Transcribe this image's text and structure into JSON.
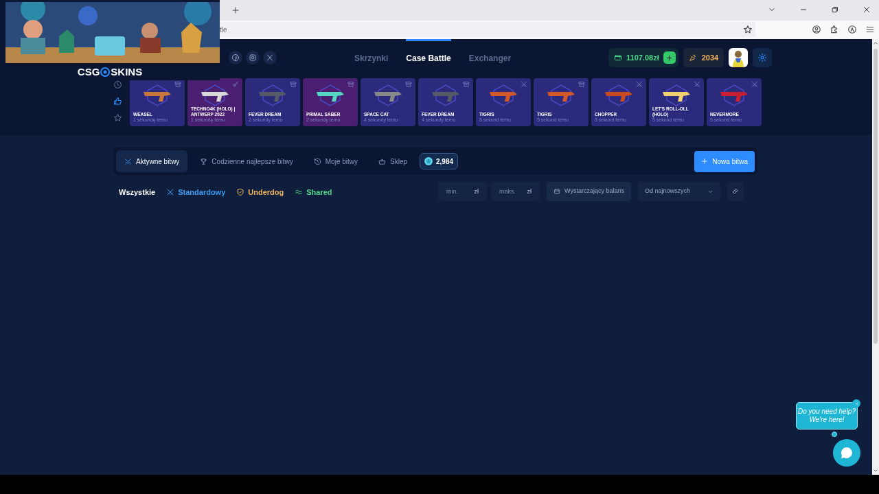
{
  "browser": {
    "address_fragment": "tle"
  },
  "overlay": {
    "logo_left": "CSG",
    "logo_right": "SKINS"
  },
  "nav": [
    {
      "label": "Skrzynki",
      "selected": false
    },
    {
      "label": "Case Battle",
      "selected": true
    },
    {
      "label": "Exchanger",
      "selected": false
    }
  ],
  "wallet": {
    "balance": "1107.08zł"
  },
  "points": "2034",
  "feed_filters": [
    {
      "kind": "recent",
      "selected": false
    },
    {
      "kind": "top",
      "selected": true
    },
    {
      "kind": "favorite",
      "selected": false
    }
  ],
  "drops": [
    {
      "name": "WEASEL",
      "time": "1 sekundę temu",
      "kind": "case",
      "color": "#2b2a7c"
    },
    {
      "name": "TECHNO4K (HOLO) | ANTWERP 2022",
      "time": "1 sekundę temu",
      "kind": "upgrade",
      "color": "#4a1f72"
    },
    {
      "name": "FEVER DREAM",
      "time": "2 sekundy temu",
      "kind": "case",
      "color": "#2b2a7c"
    },
    {
      "name": "PRIMAL SABER",
      "time": "2 sekundy temu",
      "kind": "case",
      "color": "#4a1f72"
    },
    {
      "name": "SPACE CAT",
      "time": "4 sekundy temu",
      "kind": "case",
      "color": "#2b2a7c"
    },
    {
      "name": "FEVER DREAM",
      "time": "4 sekundy temu",
      "kind": "case",
      "color": "#2b2a7c"
    },
    {
      "name": "TIGRIS",
      "time": "5 sekund temu",
      "kind": "battle",
      "color": "#2b2a7c"
    },
    {
      "name": "TIGRIS",
      "time": "5 sekund temu",
      "kind": "case",
      "color": "#2b2a7c"
    },
    {
      "name": "CHOPPER",
      "time": "5 sekund temu",
      "kind": "battle",
      "color": "#2b2a7c"
    },
    {
      "name": "LET'S ROLL-OLL (HOLO)",
      "time": "5 sekund temu",
      "kind": "battle",
      "color": "#2b2a7c"
    },
    {
      "name": "NEVERMORE",
      "time": "5 sekund temu",
      "kind": "battle",
      "color": "#2b2a7c"
    }
  ],
  "tabs": [
    {
      "label": "Aktywne bitwy",
      "kind": "swords",
      "selected": true
    },
    {
      "label": "Codzienne najlepsze bitwy",
      "kind": "trophy",
      "selected": false
    },
    {
      "label": "Moje bitwy",
      "kind": "history",
      "selected": false
    },
    {
      "label": "Sklep",
      "kind": "basket",
      "selected": false
    }
  ],
  "coins": "2,984",
  "new_battle": "Nowa bitwa",
  "modes": [
    {
      "label": "Wszystkie",
      "kind": "all",
      "color": "#ffffff"
    },
    {
      "label": "Standardowy",
      "kind": "standard",
      "color": "#3b9cf5"
    },
    {
      "label": "Underdog",
      "kind": "underdog",
      "color": "#f2b45a"
    },
    {
      "label": "Shared",
      "kind": "shared",
      "color": "#4fd88a"
    }
  ],
  "price_min": {
    "placeholder": "min.",
    "unit": "zł"
  },
  "price_max": {
    "placeholder": "maks.",
    "unit": "zł"
  },
  "balance_toggle": {
    "label": "Wystarczający balans",
    "checked": false
  },
  "sort": {
    "value": "Od najnowszych"
  },
  "chat": {
    "lines": [
      "Do you need help?",
      "We're here!"
    ]
  }
}
